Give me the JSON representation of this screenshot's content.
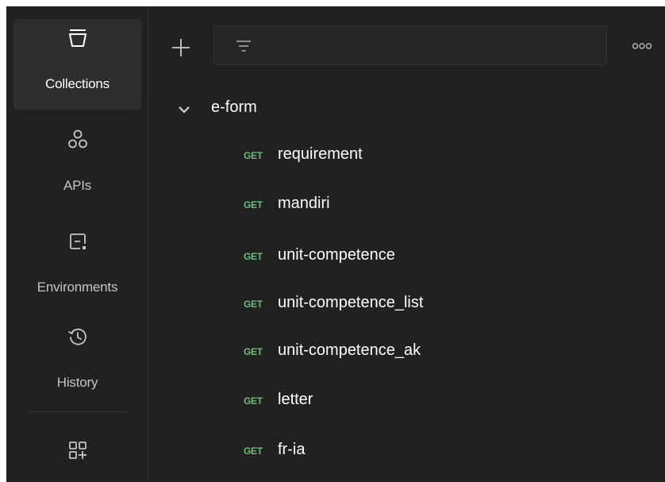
{
  "sidebar": {
    "items": [
      {
        "label": "Collections",
        "icon": "collections-icon",
        "active": true
      },
      {
        "label": "APIs",
        "icon": "apis-icon",
        "active": false
      },
      {
        "label": "Environments",
        "icon": "environments-icon",
        "active": false
      },
      {
        "label": "History",
        "icon": "history-icon",
        "active": false
      }
    ],
    "bottom_icon": "add-workspace-icon"
  },
  "toolbar": {
    "add_icon": "plus-icon",
    "filter_icon": "filter-icon",
    "more_icon": "more-options-icon"
  },
  "collection": {
    "name": "e-form",
    "expanded": true,
    "requests": [
      {
        "method": "GET",
        "name": "requirement"
      },
      {
        "method": "GET",
        "name": "mandiri"
      },
      {
        "method": "GET",
        "name": "unit-competence"
      },
      {
        "method": "GET",
        "name": "unit-competence_list"
      },
      {
        "method": "GET",
        "name": "unit-competence_ak"
      },
      {
        "method": "GET",
        "name": "letter"
      },
      {
        "method": "GET",
        "name": "fr-ia"
      }
    ]
  },
  "colors": {
    "background": "#212121",
    "active_item": "#2e2e2e",
    "get_method": "#6bbd7a",
    "text": "#ffffff",
    "muted_text": "#c5c5c5"
  }
}
